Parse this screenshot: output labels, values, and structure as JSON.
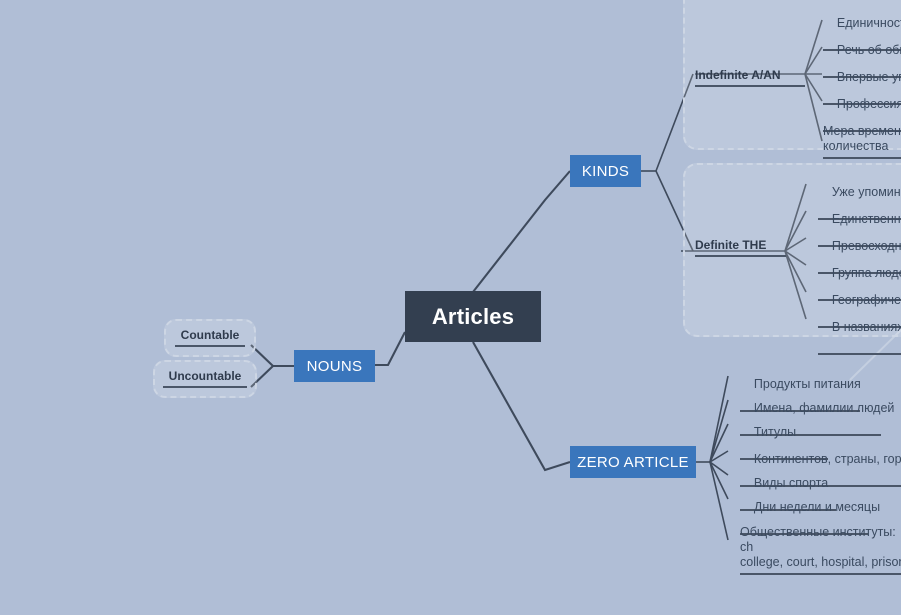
{
  "diagram": {
    "title": "Articles",
    "background_color": "#b0bed6",
    "accent_color": "#3a76bc",
    "root_color": "#333f50",
    "line_color": "#3e4a5c"
  },
  "root": {
    "label": "Articles"
  },
  "nouns_branch": {
    "label": "NOUNS",
    "children": [
      {
        "label": "Countable"
      },
      {
        "label": "Uncountable"
      }
    ]
  },
  "kinds_branch": {
    "label": "KINDS",
    "groups": [
      {
        "title": "Indefinite A/AN",
        "items": [
          {
            "label": "Единичность"
          },
          {
            "label": "Речь об общ"
          },
          {
            "label": "Впервые уп"
          },
          {
            "label": "Профессия,"
          },
          {
            "label": "Мера времени\nколичества"
          }
        ]
      },
      {
        "title": "Definite THE",
        "items": [
          {
            "label": "Уже упоминало"
          },
          {
            "label": "Единственный"
          },
          {
            "label": "Превосходная"
          },
          {
            "label": "Группа людей"
          },
          {
            "label": "Географически"
          },
          {
            "label": "В названиях"
          }
        ]
      }
    ]
  },
  "zero_article_branch": {
    "label": "ZERO ARTICLE",
    "items": [
      {
        "label": "Продукты питания"
      },
      {
        "label": "Имена, фамилии людей"
      },
      {
        "label": "Титулы"
      },
      {
        "label": "Континентов, страны, города"
      },
      {
        "label": "Виды спорта"
      },
      {
        "label": "Дни недели и месяцы"
      },
      {
        "label": "Общественные институты: ch\ncollege, court, hospital, prison,"
      }
    ]
  }
}
